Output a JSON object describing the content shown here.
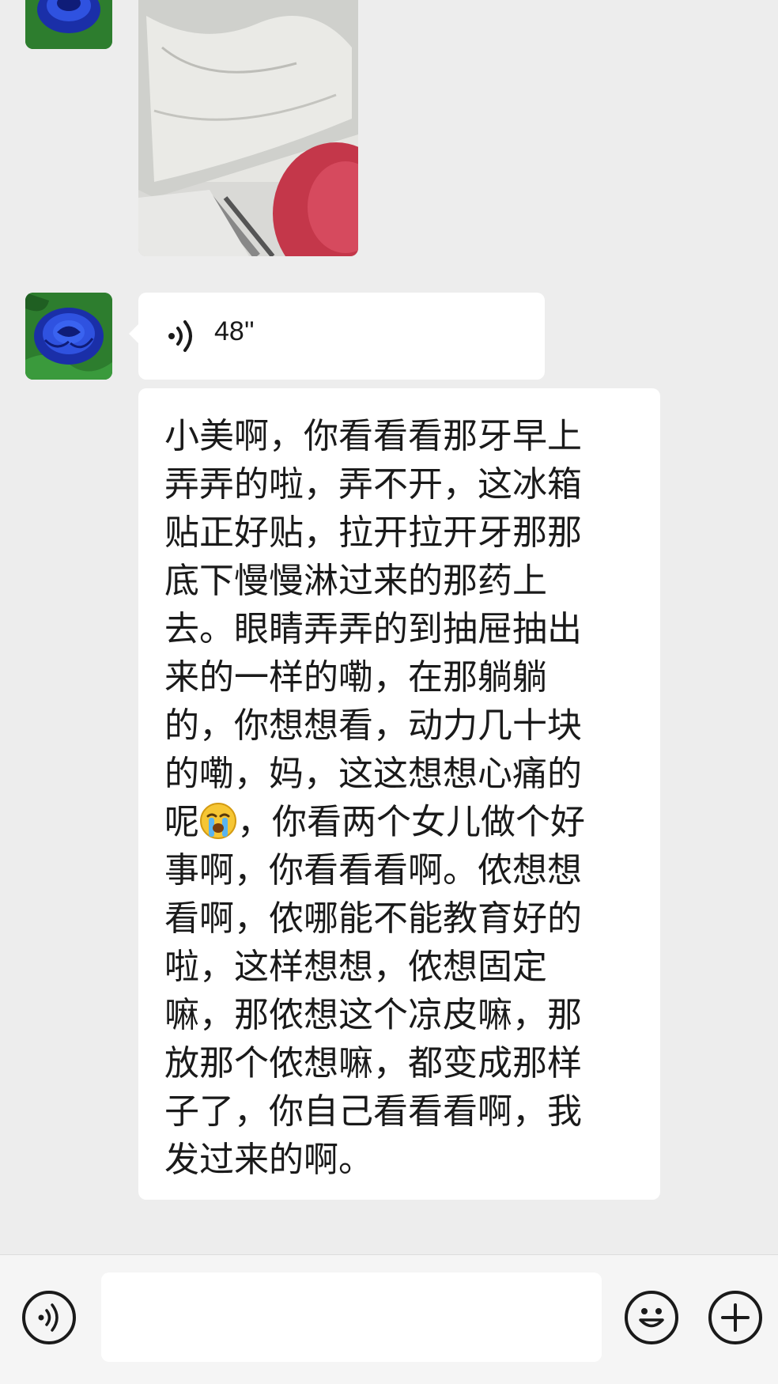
{
  "messages": [
    {
      "type": "image",
      "sender_avatar": "blue-rose-avatar"
    },
    {
      "type": "voice",
      "duration": "48''",
      "icon": "voice-wave-icon"
    },
    {
      "type": "text",
      "lines": [
        "小美啊，你看看看那牙早上",
        "弄弄的啦，弄不开，这冰箱",
        "贴正好贴，拉开拉开牙那那",
        "底下慢慢淋过来的那药上",
        "去。眼睛弄弄的到抽屉抽出",
        "来的一样的嘞，在那躺躺",
        "的，你想想看，动力几十块",
        "的嘞，妈，这这想想心痛的",
        "呢",
        "，你看两个女儿做个好",
        "事啊，你看看看啊。侬想想",
        "看啊，侬哪能不能教育好的",
        "啦，这样想想，侬想固定",
        "嘛，那侬想这个凉皮嘛，那",
        "放那个侬想嘛，都变成那样",
        "子了，你自己看看看啊，我",
        "发过来的啊。"
      ],
      "emoji": "crying-face-emoji"
    }
  ],
  "input_bar": {
    "voice_button_icon": "voice-input-icon",
    "text_value": "",
    "emoji_button_icon": "smiley-icon",
    "more_button_icon": "plus-icon"
  }
}
